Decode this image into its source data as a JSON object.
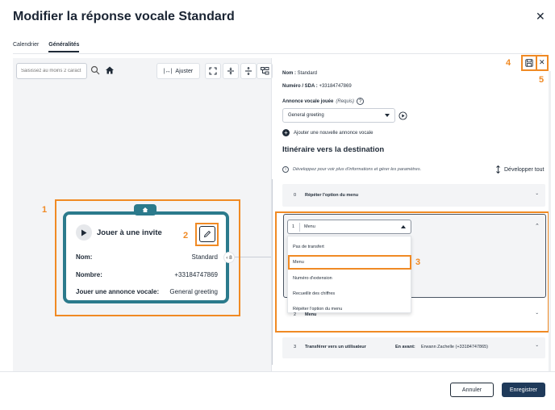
{
  "modal": {
    "title": "Modifier la réponse vocale Standard",
    "close_glyph": "✕"
  },
  "tabs": [
    {
      "label": "Calendrier",
      "active": false
    },
    {
      "label": "Généralités",
      "active": true
    }
  ],
  "toolbar": {
    "search_placeholder": "Saisissez au moins 2 caract",
    "ajuster_label": "Ajuster"
  },
  "node": {
    "title": "Jouer à une invite",
    "rows": [
      {
        "key": "Nom:",
        "value": "Standard"
      },
      {
        "key": "Nombre:",
        "value": "+33184747869"
      },
      {
        "key": "Jouer une annonce vocale:",
        "value": "General greeting"
      }
    ],
    "collapse_label": "‹ 8"
  },
  "annotations": {
    "n1": "1",
    "n2": "2",
    "n3": "3",
    "n4": "4",
    "n5": "5"
  },
  "panel": {
    "nom_key": "Nom :",
    "nom_value": "Standard",
    "sda_key": "Numéro / SDA :",
    "sda_value": "+33184747869",
    "annonce_label": "Annonce vocale jouée",
    "annonce_required": "(Requis)",
    "annonce_selected": "General greeting",
    "add_annonce": "Ajouter une nouvelle annonce vocale",
    "section_title": "Itinéraire vers la destination",
    "info_text": "Développez pour voir plus d'informations et gérer les paramètres.",
    "expand_all": "Développer tout",
    "items": [
      {
        "num": "0",
        "label": "Répéter l'option du menu"
      },
      {
        "num": "1",
        "label": "Menu"
      },
      {
        "num": "2",
        "label": "Menu"
      },
      {
        "num": "3",
        "label": "Transférer vers un utilisateur",
        "extra_key": "En avant:",
        "extra_value": "Erwann Zachelle (+33184747865)"
      }
    ],
    "dropdown_options": [
      "Pas de transfert",
      "Menu",
      "Numéro d'extension",
      "Recueillir des chiffres",
      "Répéter l'option du menu"
    ]
  },
  "footer": {
    "cancel": "Annuler",
    "save": "Enregistrer"
  },
  "colors": {
    "accent_orange": "#f08a24",
    "node_teal": "#2b7a8c",
    "primary_button": "#1f3a5a"
  }
}
